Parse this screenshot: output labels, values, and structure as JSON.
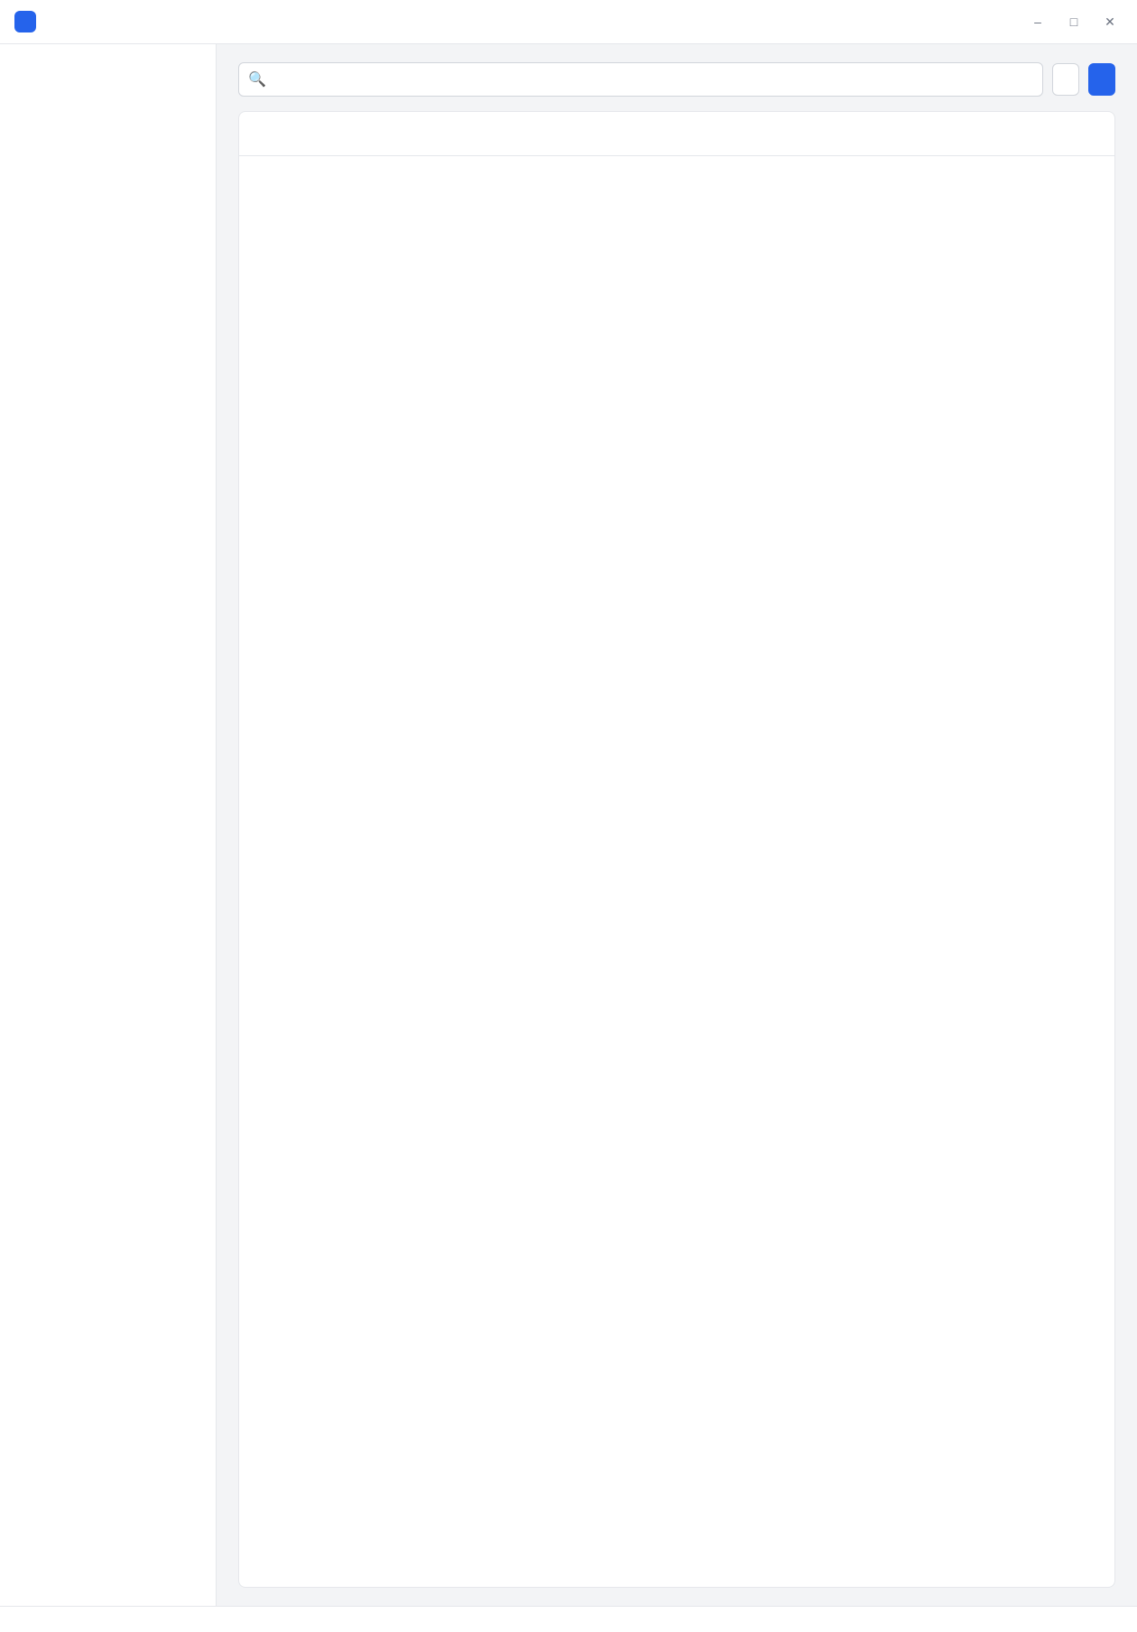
{
  "window": {
    "title": ""
  },
  "sidebar": {
    "items": []
  },
  "toolbar": {
    "search_placeholder": "",
    "primary_label": "",
    "secondary_label": ""
  },
  "main": {
    "card_title": "",
    "columns": [],
    "rows": []
  },
  "statusbar": {
    "text": ""
  },
  "colors": {
    "accent": "#2563eb"
  }
}
